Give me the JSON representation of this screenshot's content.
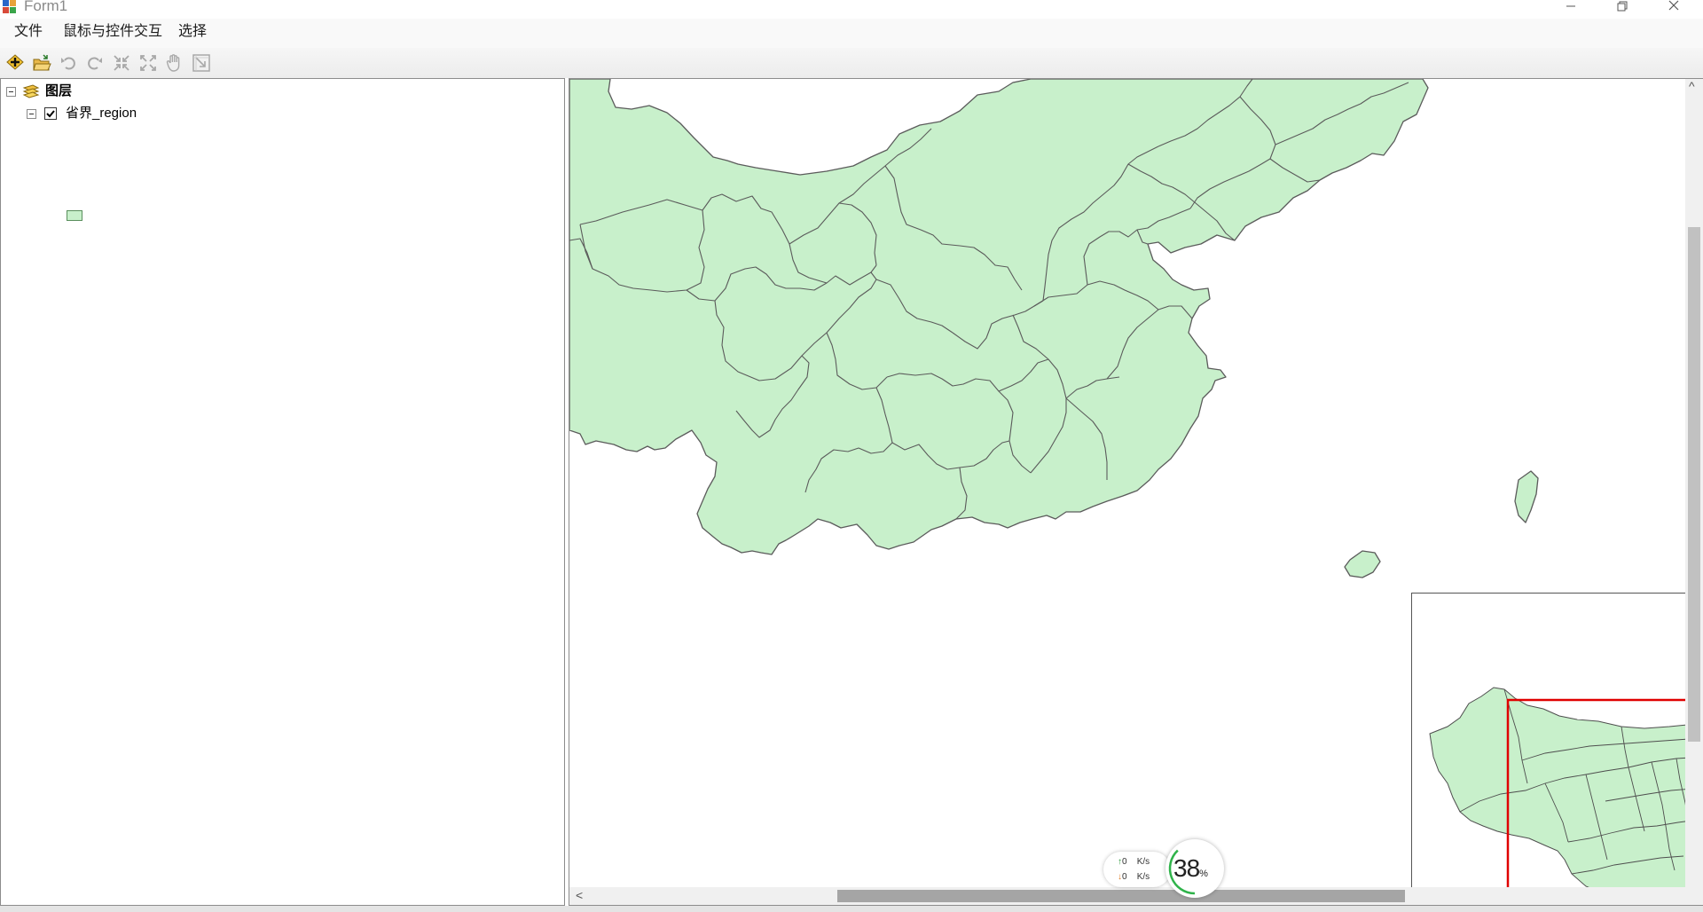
{
  "window": {
    "title": "Form1",
    "icon": "app-form-icon",
    "controls": [
      "minimize-icon",
      "restore-icon",
      "close-icon"
    ]
  },
  "menubar": {
    "items": [
      {
        "label": "文件"
      },
      {
        "label": "鼠标与控件交互"
      },
      {
        "label": "选择"
      }
    ]
  },
  "toolbar": {
    "tools": [
      "add-data-icon",
      "open-document-icon",
      "undo-icon",
      "redo-icon",
      "zoom-in-fixed-icon",
      "zoom-out-fixed-icon",
      "pan-hand-icon",
      "full-extent-icon"
    ]
  },
  "toc": {
    "root_label": "图层",
    "layer": {
      "label": "省界_region",
      "checked": true,
      "fill_color": "#c8f0cb"
    }
  },
  "map": {
    "fill_color": "#c8f0cb",
    "stroke_color": "#5b5b5b",
    "overview_extent_color": "#e00000"
  },
  "netmonitor": {
    "upload_value": "0",
    "upload_unit": "K/s",
    "download_value": "0",
    "download_unit": "K/s",
    "cpu_percent": "38",
    "percent_sign": "%",
    "cpu_fraction": 0.38
  }
}
